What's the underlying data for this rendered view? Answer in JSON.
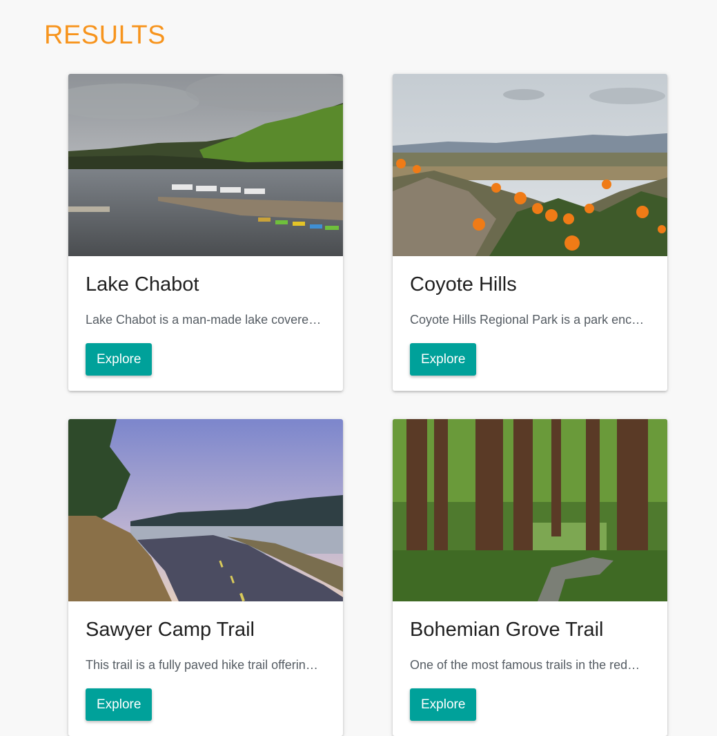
{
  "page": {
    "title": "RESULTS"
  },
  "cards": [
    {
      "title": "Lake Chabot",
      "description": "Lake Chabot is a man-made lake covered with trails and boat docks",
      "button_label": "Explore",
      "image": "lake-chabot-marina-photo"
    },
    {
      "title": "Coyote Hills",
      "description": "Coyote Hills Regional Park is a park encompassing marshland and hills",
      "button_label": "Explore",
      "image": "coyote-hills-poppies-photo"
    },
    {
      "title": "Sawyer Camp Trail",
      "description": "This trail is a fully paved hike trail offering views of the reservoir",
      "button_label": "Explore",
      "image": "sawyer-camp-trail-road-photo"
    },
    {
      "title": "Bohemian Grove Trail",
      "description": "One of the most famous trails in the redwood forest",
      "button_label": "Explore",
      "image": "bohemian-grove-redwoods-photo"
    }
  ]
}
